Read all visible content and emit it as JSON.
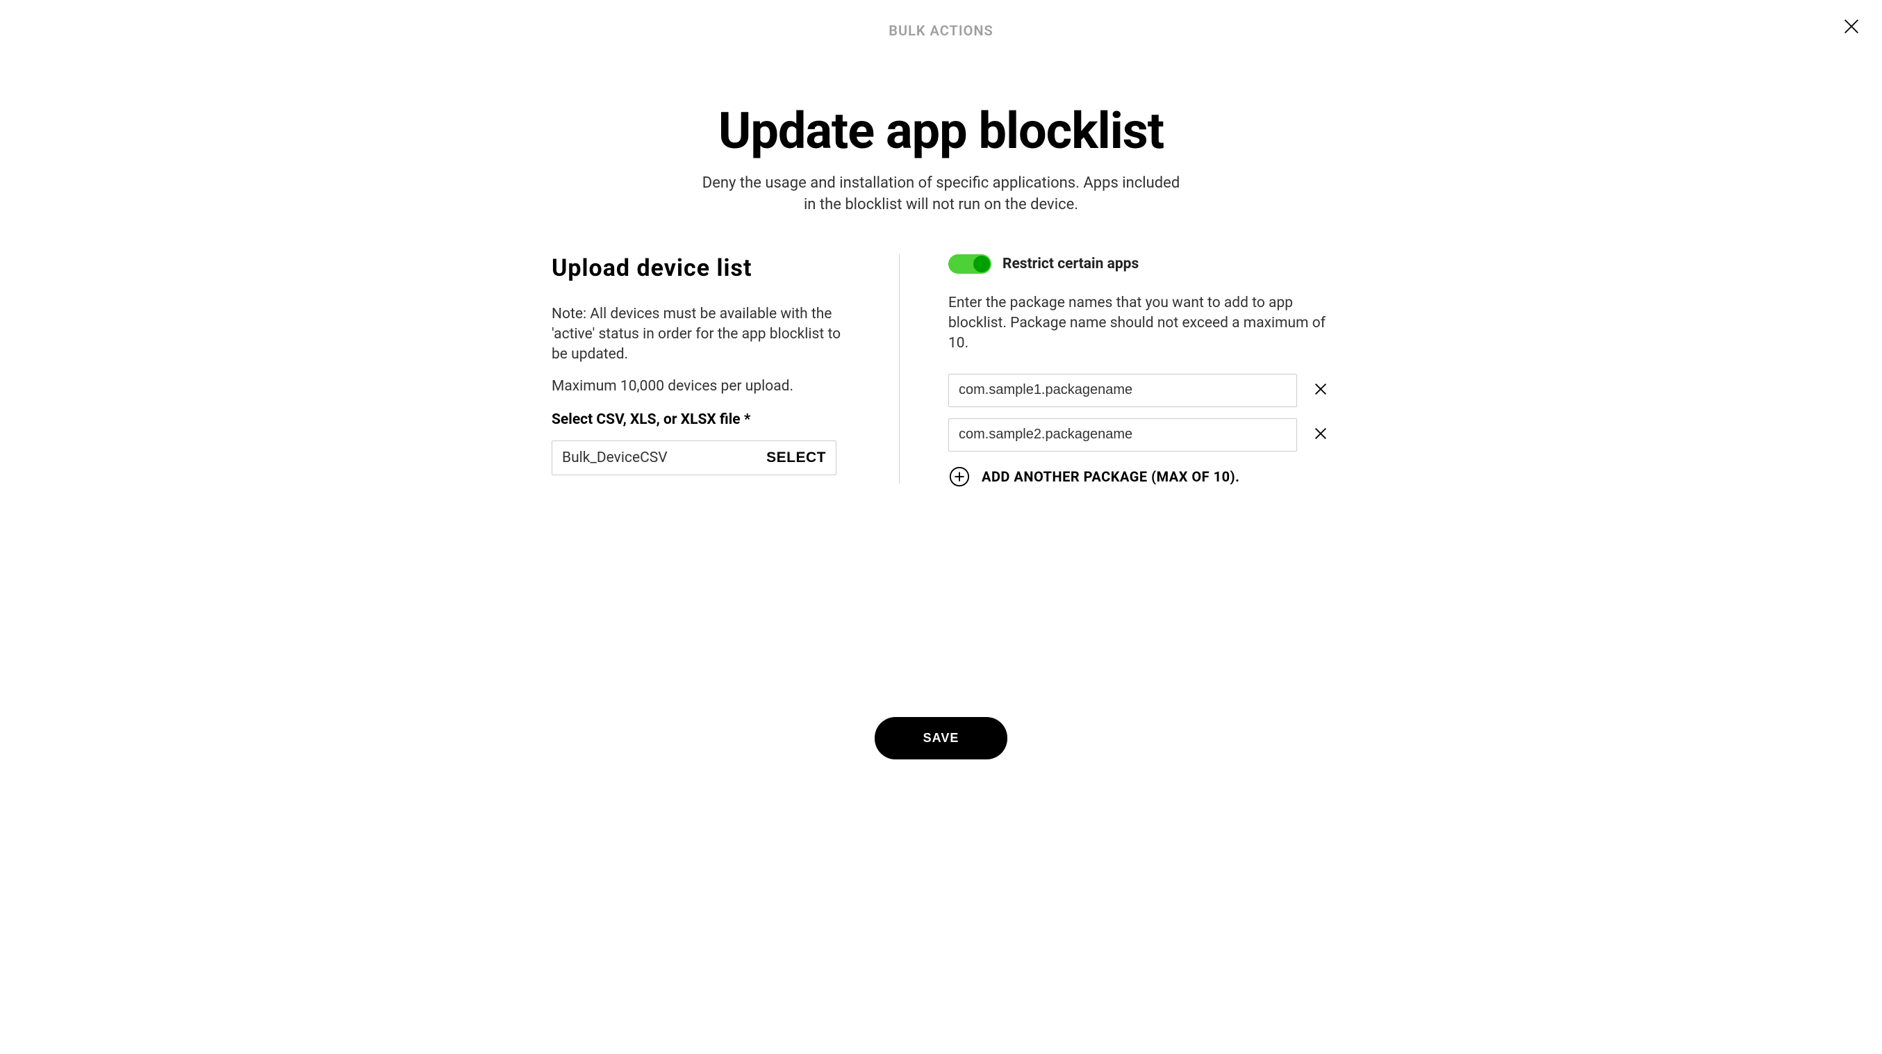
{
  "header": {
    "label": "BULK ACTIONS"
  },
  "title": "Update app blocklist",
  "subtitle": "Deny the usage and installation of specific applications. Apps included in the blocklist will not run on the device.",
  "upload": {
    "title": "Upload device list",
    "note": "Note: All devices must be available with the 'active' status in order for the app blocklist to be updated.",
    "max": "Maximum 10,000 devices per upload.",
    "field_label": "Select CSV, XLS, or XLSX file *",
    "file_name": "Bulk_DeviceCSV",
    "select_label": "SELECT"
  },
  "restrict": {
    "toggle_label": "Restrict certain apps",
    "toggle_on": true,
    "instruction": "Enter the package names that you want to add to app blocklist. Package name should not exceed a maximum of 10.",
    "packages": [
      "com.sample1.packagename",
      "com.sample2.packagename"
    ],
    "add_label": "ADD ANOTHER PACKAGE (MAX OF 10)."
  },
  "save_label": "SAVE"
}
